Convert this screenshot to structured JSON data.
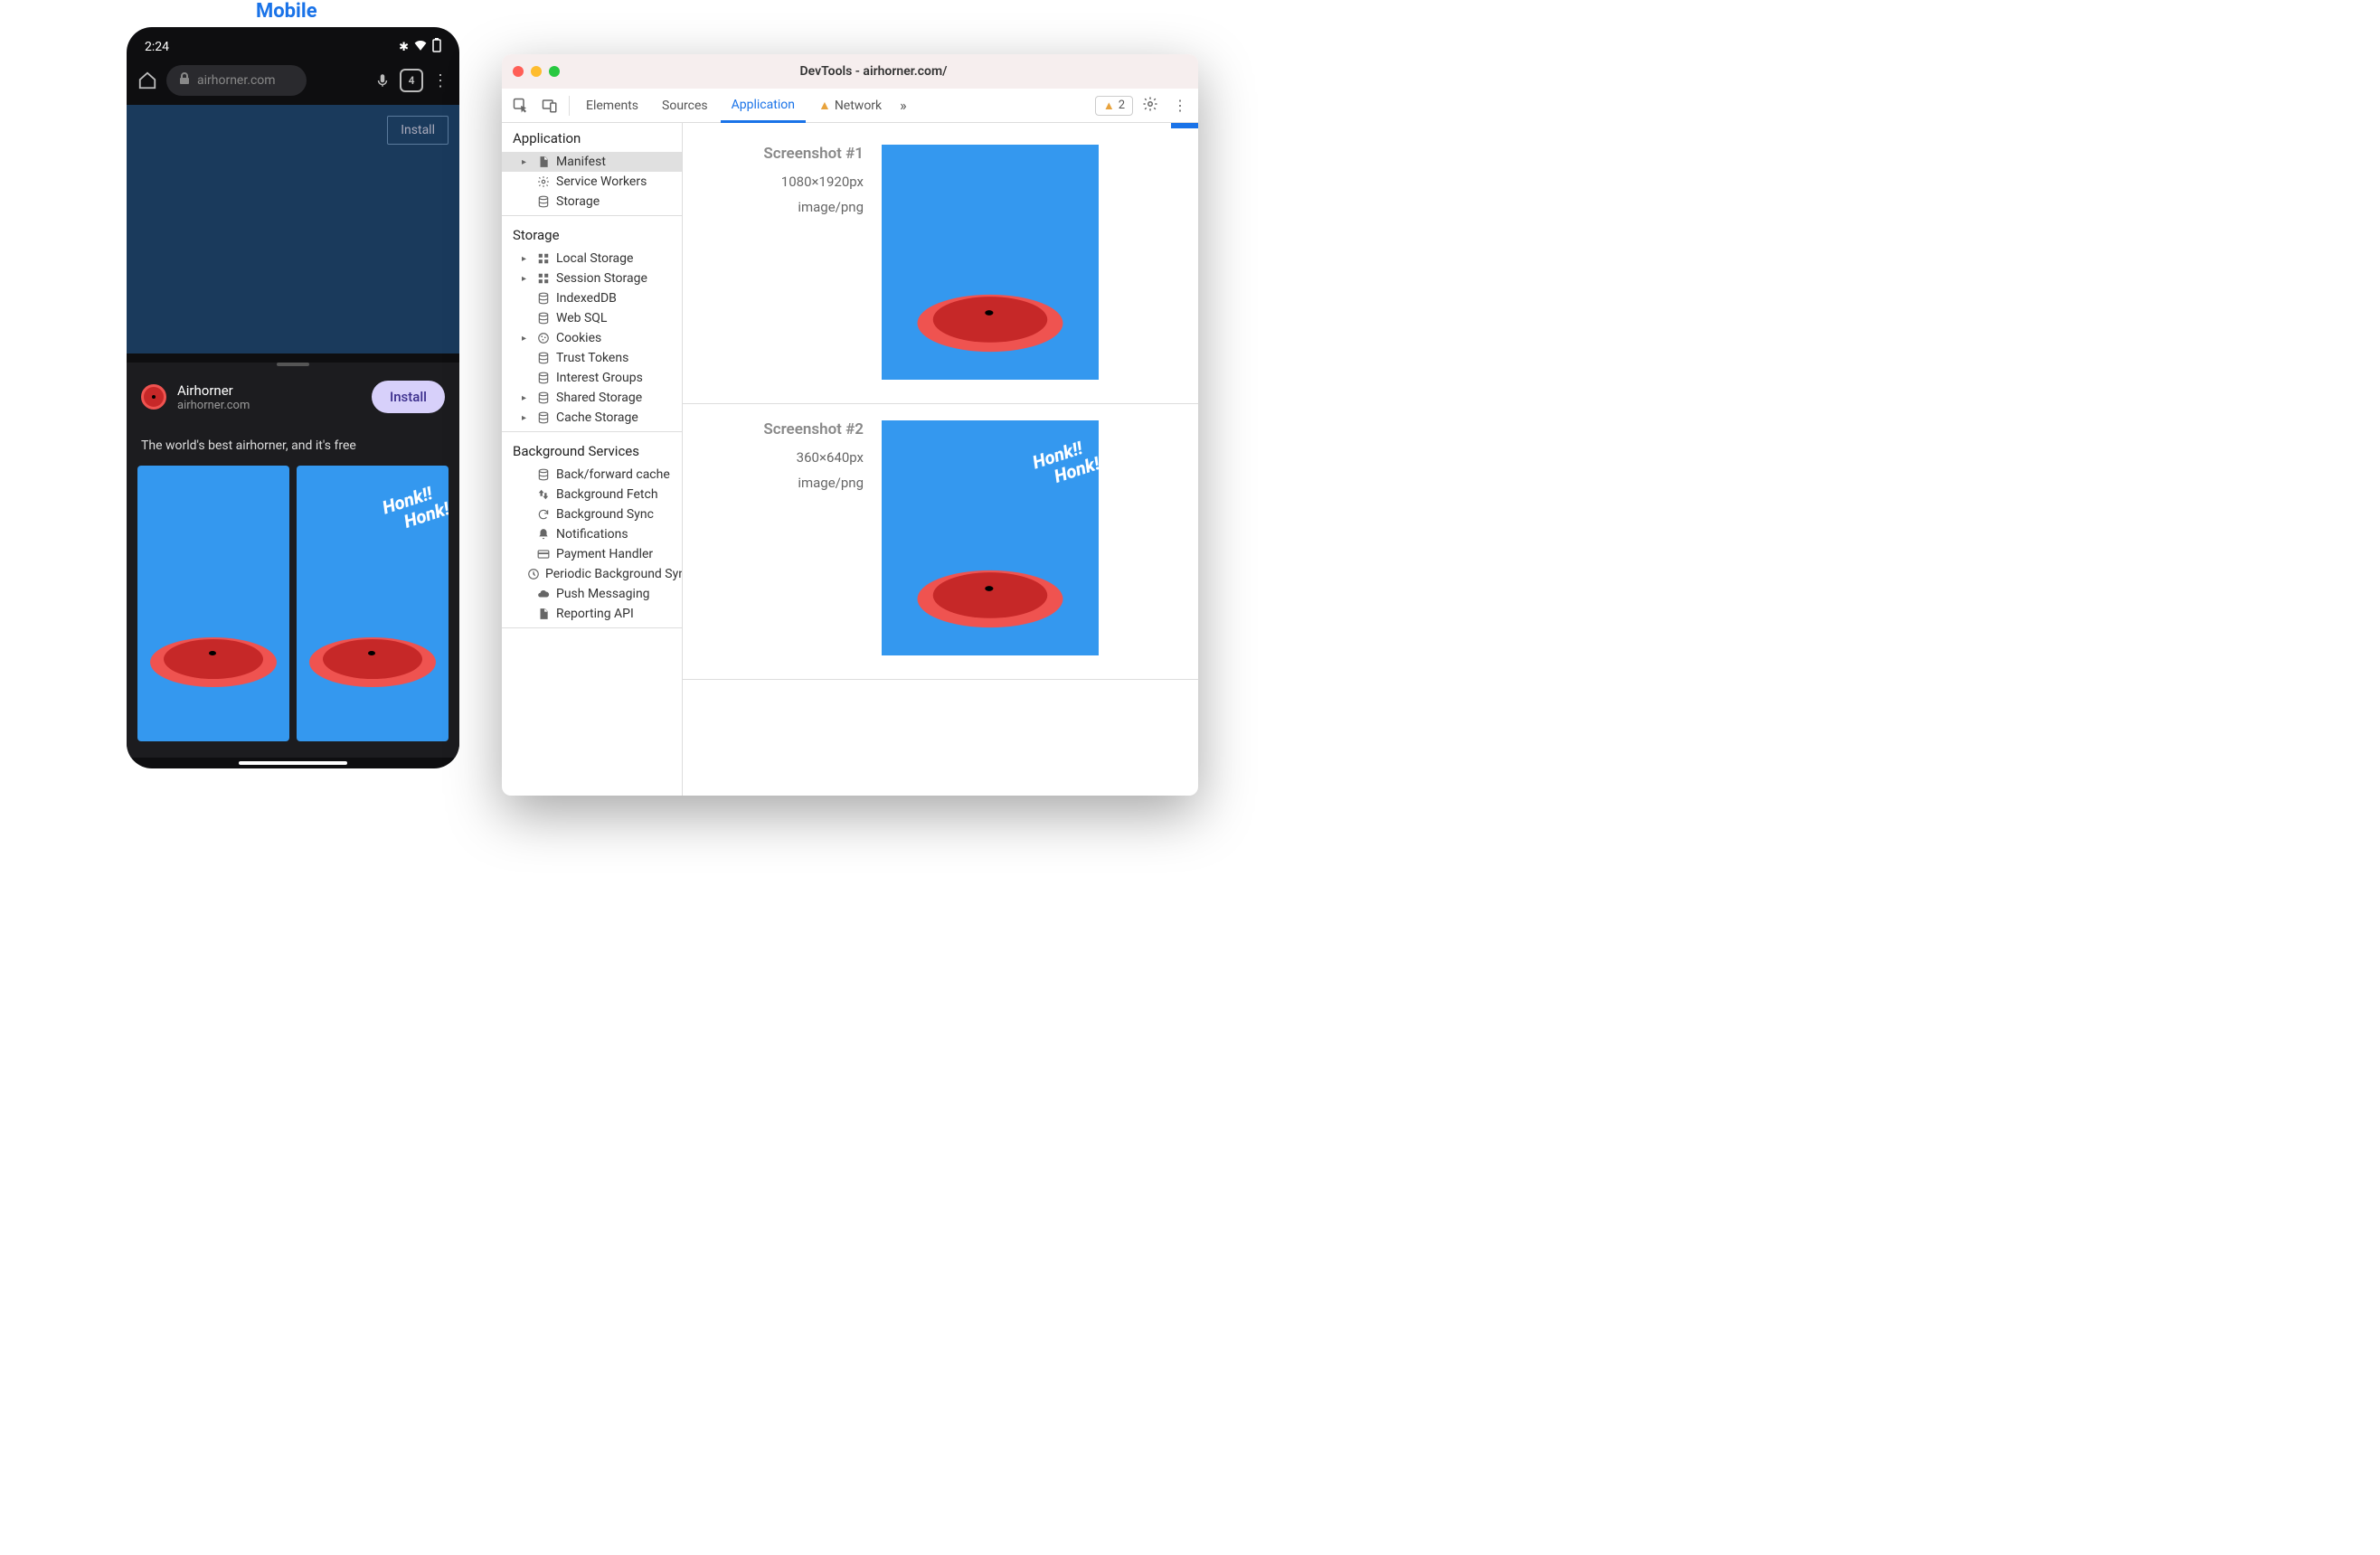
{
  "label_mobile": "Mobile",
  "mobile": {
    "time": "2:24",
    "status_icons": {
      "bt": "✱",
      "wifi": "▾",
      "batt": "▮"
    },
    "url": "airhorner.com",
    "tab_count": "4",
    "install_top": "Install",
    "sheet": {
      "app_name": "Airhorner",
      "app_domain": "airhorner.com",
      "install_btn": "Install",
      "description": "The world's best airhorner, and it's free"
    },
    "honk": "Honk!!"
  },
  "devtools": {
    "title": "DevTools - airhorner.com/",
    "lights": [
      "#ff5f57",
      "#febc2e",
      "#28c840"
    ],
    "tabs": [
      "Elements",
      "Sources",
      "Application",
      "Network"
    ],
    "active_tab": "Application",
    "warning_count": "2",
    "sidebar": {
      "groups": [
        {
          "title": "Application",
          "items": [
            {
              "label": "Manifest",
              "icon": "file",
              "arrow": true,
              "selected": true
            },
            {
              "label": "Service Workers",
              "icon": "gear"
            },
            {
              "label": "Storage",
              "icon": "db"
            }
          ]
        },
        {
          "title": "Storage",
          "items": [
            {
              "label": "Local Storage",
              "icon": "grid",
              "arrow": true
            },
            {
              "label": "Session Storage",
              "icon": "grid",
              "arrow": true
            },
            {
              "label": "IndexedDB",
              "icon": "db"
            },
            {
              "label": "Web SQL",
              "icon": "db"
            },
            {
              "label": "Cookies",
              "icon": "cookie",
              "arrow": true
            },
            {
              "label": "Trust Tokens",
              "icon": "db"
            },
            {
              "label": "Interest Groups",
              "icon": "db"
            },
            {
              "label": "Shared Storage",
              "icon": "db",
              "arrow": true
            },
            {
              "label": "Cache Storage",
              "icon": "db",
              "arrow": true
            }
          ]
        },
        {
          "title": "Background Services",
          "items": [
            {
              "label": "Back/forward cache",
              "icon": "db"
            },
            {
              "label": "Background Fetch",
              "icon": "updown"
            },
            {
              "label": "Background Sync",
              "icon": "sync"
            },
            {
              "label": "Notifications",
              "icon": "bell"
            },
            {
              "label": "Payment Handler",
              "icon": "card"
            },
            {
              "label": "Periodic Background Sync",
              "icon": "clock"
            },
            {
              "label": "Push Messaging",
              "icon": "cloud"
            },
            {
              "label": "Reporting API",
              "icon": "file"
            }
          ]
        }
      ]
    },
    "screenshots": [
      {
        "title": "Screenshot #1",
        "dim": "1080×1920px",
        "mime": "image/png",
        "honk": false
      },
      {
        "title": "Screenshot #2",
        "dim": "360×640px",
        "mime": "image/png",
        "honk": true
      }
    ]
  }
}
